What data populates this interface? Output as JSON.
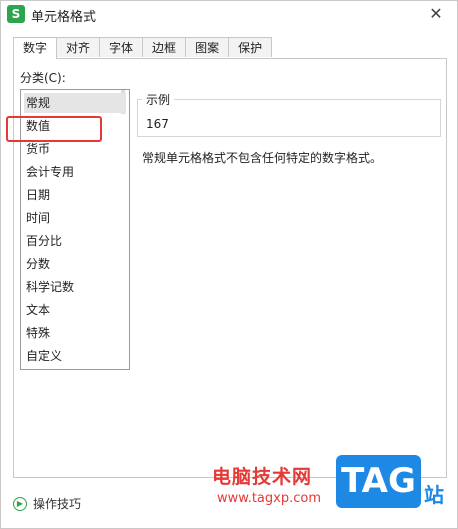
{
  "window": {
    "title": "单元格格式",
    "app_icon": "S",
    "close": "✕"
  },
  "tabs": [
    "数字",
    "对齐",
    "字体",
    "边框",
    "图案",
    "保护"
  ],
  "category": {
    "label": "分类(C):",
    "items": [
      "常规",
      "数值",
      "货币",
      "会计专用",
      "日期",
      "时间",
      "百分比",
      "分数",
      "科学记数",
      "文本",
      "特殊",
      "自定义"
    ],
    "selected": "常规"
  },
  "sample": {
    "label": "示例",
    "value": "167"
  },
  "description": "常规单元格格式不包含任何特定的数字格式。",
  "footer": {
    "tips": "操作技巧"
  },
  "watermark": {
    "site_cn": "电脑技术网",
    "url": "www.tagxp.com",
    "logo": "TAG",
    "suffix": "站"
  },
  "colors": {
    "highlight": "#e53935",
    "tip_icon": "#2da44e",
    "logo": "#1e88e5"
  }
}
